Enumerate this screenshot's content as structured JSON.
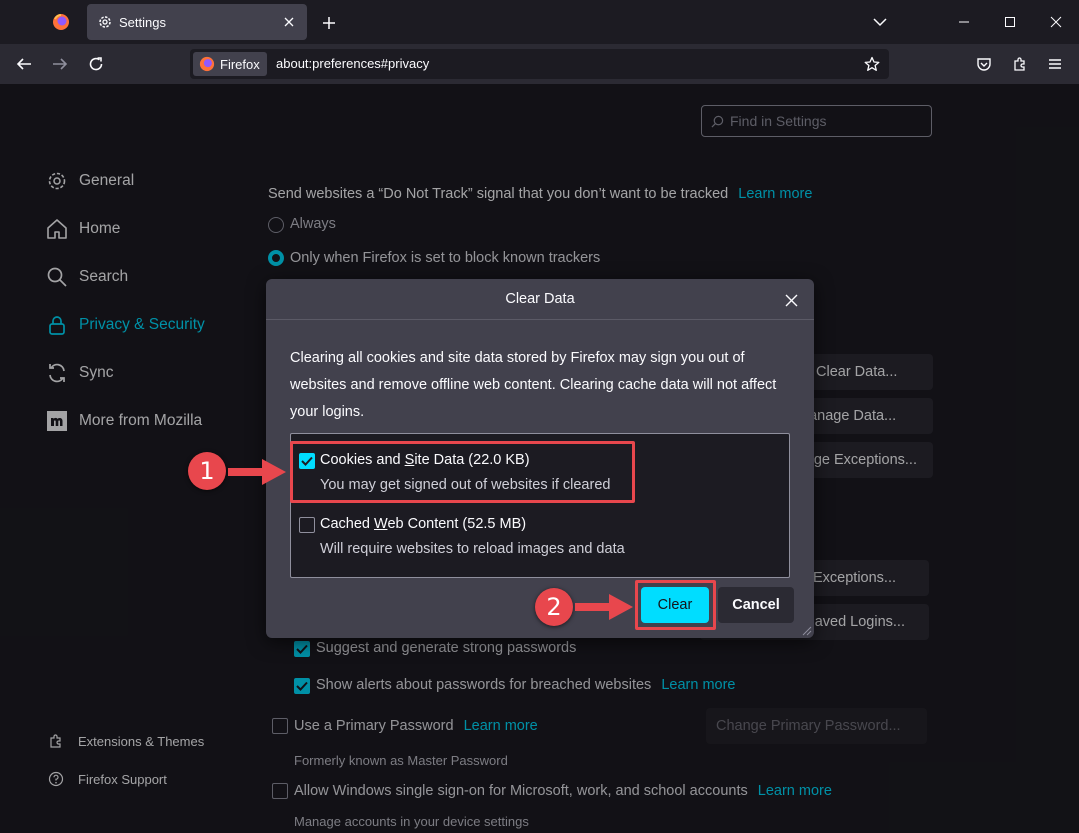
{
  "tab": {
    "title": "Settings"
  },
  "urlbar": {
    "identity": "Firefox",
    "url": "about:preferences#privacy"
  },
  "search": {
    "placeholder": "Find in Settings"
  },
  "categories": [
    {
      "label": "General"
    },
    {
      "label": "Home"
    },
    {
      "label": "Search"
    },
    {
      "label": "Privacy & Security"
    },
    {
      "label": "Sync"
    },
    {
      "label": "More from Mozilla"
    }
  ],
  "footer": {
    "extensions": "Extensions & Themes",
    "support": "Firefox Support"
  },
  "dnt": {
    "text": "Send websites a “Do Not Track” signal that you don’t want to be tracked",
    "learn_more": "Learn more",
    "always": "Always",
    "only_when": "Only when Firefox is set to block known trackers"
  },
  "side_buttons": {
    "clear_data": "Clear Data...",
    "manage_data": "Manage Data...",
    "manage_exceptions": "Manage Exceptions...",
    "exceptions": "Exceptions...",
    "saved_logins": "Saved Logins...",
    "change_primary": "Change Primary Password..."
  },
  "logins": {
    "suggest": "Suggest and generate strong passwords",
    "alerts": "Show alerts about passwords for breached websites",
    "alerts_learn": "Learn more",
    "primary": "Use a Primary Password",
    "primary_learn": "Learn more",
    "formerly": "Formerly known as Master Password",
    "sso": "Allow Windows single sign-on for Microsoft, work, and school accounts",
    "sso_learn": "Learn more",
    "sso_sub": "Manage accounts in your device settings"
  },
  "dialog": {
    "title": "Clear Data",
    "description": "Clearing all cookies and site data stored by Firefox may sign you out of websites and remove offline web content. Clearing cache data will not affect your logins.",
    "cookies_label_pre": "Cookies and ",
    "cookies_label_ul": "S",
    "cookies_label_post": "ite Data (22.0 KB)",
    "cookies_sub": "You may get signed out of websites if cleared",
    "cache_label_pre": "Cached ",
    "cache_label_ul": "W",
    "cache_label_post": "eb Content (52.5 MB)",
    "cache_sub": "Will require websites to reload images and data",
    "clear": "Clear",
    "cancel": "Cancel",
    "cookies_checked": true,
    "cache_checked": false
  },
  "annotations": {
    "step1": "1",
    "step2": "2"
  },
  "colors": {
    "accent": "#00ddff",
    "highlight": "#e8474d",
    "background": "#1c1b22",
    "dialog": "#42414d"
  }
}
